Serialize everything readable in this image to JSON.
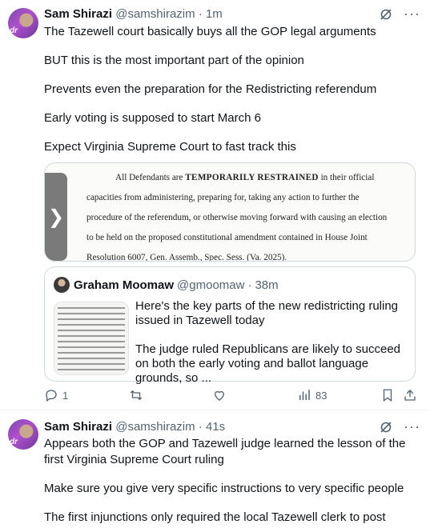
{
  "post1": {
    "author_name": "Sam Shirazi",
    "author_handle": "@samshirazim",
    "separator": "·",
    "time": "1m",
    "paragraphs": [
      "The Tazewell court basically buys all the GOP legal arguments",
      "BUT this is the most important part of the opinion",
      "Prevents even the preparation for the Redistricting referendum",
      "Early voting is supposed to start March 6",
      "Expect Virginia Supreme Court to fast track this"
    ],
    "media": {
      "line1_prefix": "All Defendants are",
      "line1_bold": "TEMPORARILY RESTRAINED",
      "line1_suffix": "in their official",
      "line2": "capacities from administering, preparing for, taking any action to further the",
      "line3": "procedure of the referendum, or otherwise moving forward with causing an election",
      "line4": "to be held on the proposed constitutional amendment contained in House Joint",
      "line5": "Resolution 6007, Gen. Assemb., Spec. Sess. (Va. 2025).",
      "nav_glyph": "❯"
    },
    "quote": {
      "author_name": "Graham Moomaw",
      "author_handle": "@gmoomaw",
      "separator": "·",
      "time": "38m",
      "paragraphs": [
        "Here's the key parts of the new redistricting ruling issued in Tazewell today",
        "The judge ruled Republicans are likely to succeed on both the early voting and ballot language grounds, so ..."
      ]
    },
    "actions": {
      "reply_count": "1",
      "repost_count": "",
      "like_count": "",
      "views_count": "83"
    }
  },
  "post2": {
    "author_name": "Sam Shirazi",
    "author_handle": "@samshirazim",
    "separator": "·",
    "time": "41s",
    "paragraphs": [
      "Appears both the GOP and Tazewell judge learned the lesson of the first Virginia Supreme Court ruling",
      "Make sure you give very specific instructions to very specific people",
      "The first injunctions only required the local Tazewell clerk to post notices"
    ]
  },
  "colors": {
    "text": "#0f1419",
    "secondary": "#536471",
    "border": "#cfd9de",
    "divider": "#eff3f4"
  },
  "icons": [
    "grok-icon",
    "more-icon",
    "reply-icon",
    "repost-icon",
    "like-icon",
    "views-icon",
    "bookmark-icon",
    "share-icon"
  ]
}
